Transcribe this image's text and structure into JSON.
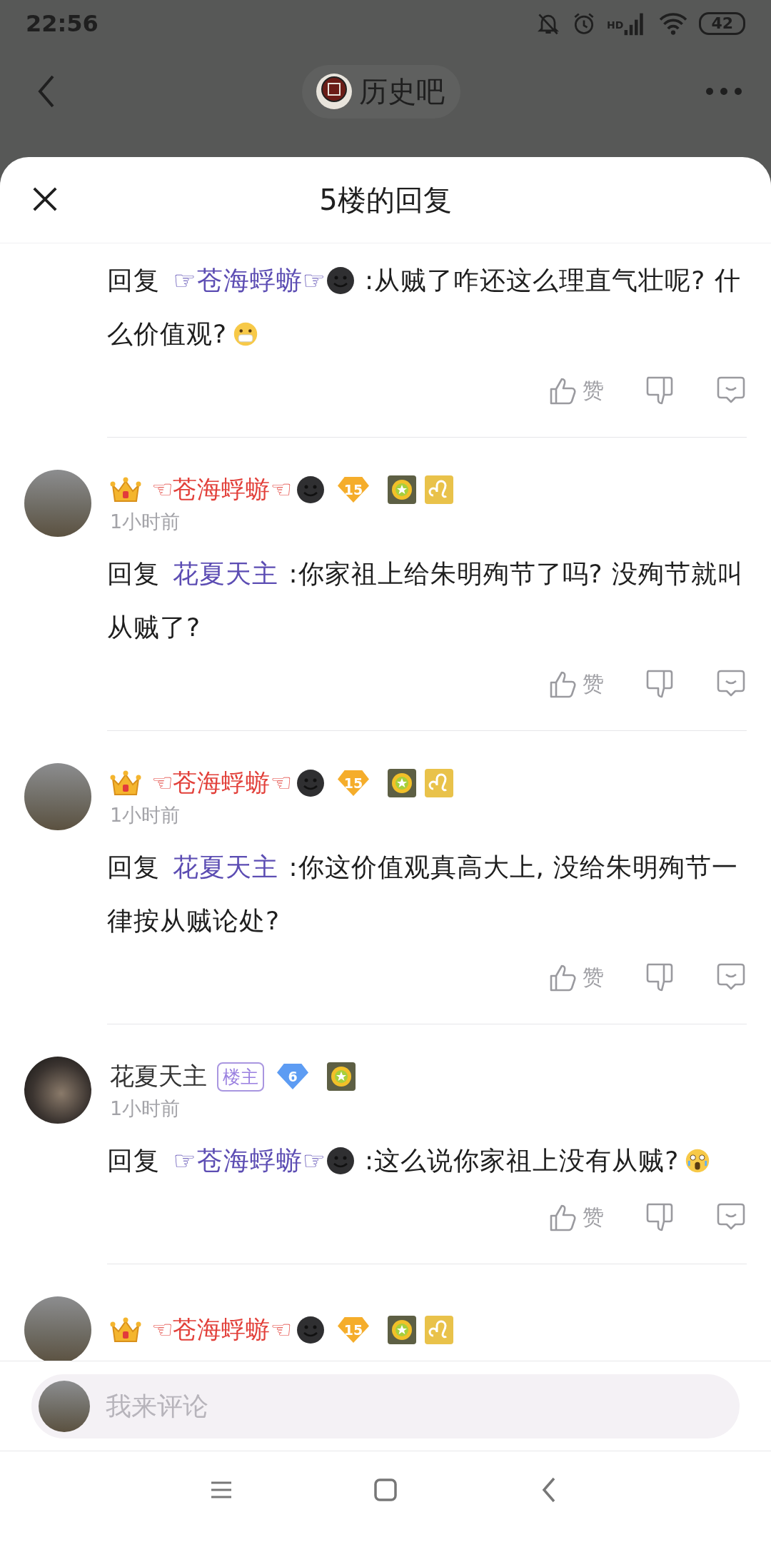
{
  "status_bar": {
    "time": "22:56",
    "network_label": "HD",
    "battery": "42"
  },
  "nav": {
    "forum": "历史吧"
  },
  "sheet": {
    "title": "5楼的回复"
  },
  "comments": [
    {
      "reply": {
        "prefix": "回复",
        "target": {
          "name": "☞苍海蜉蝣☞",
          "kind": "vip"
        },
        "text": ":从贼了咋还这么理直气壮呢? 什么价值观?",
        "emoji": {
          "kind": "mask"
        }
      },
      "like_label": "赞"
    },
    {
      "author": {
        "kind": "vip",
        "name": "☜苍海蜉蝣☜",
        "level": "15",
        "time": "1小时前"
      },
      "reply": {
        "prefix": "回复",
        "target": {
          "name": "花夏天主",
          "kind": "plain"
        },
        "text": ":你家祖上给朱明殉节了吗? 没殉节就叫从贼了?"
      },
      "like_label": "赞"
    },
    {
      "author": {
        "kind": "vip",
        "name": "☜苍海蜉蝣☜",
        "level": "15",
        "time": "1小时前"
      },
      "reply": {
        "prefix": "回复",
        "target": {
          "name": "花夏天主",
          "kind": "plain"
        },
        "text": ":你这价值观真高大上, 没给朱明殉节一律按从贼论处?"
      },
      "like_label": "赞"
    },
    {
      "author": {
        "kind": "plain",
        "name": "花夏天主",
        "tag": "楼主",
        "level": "6",
        "time": "1小时前"
      },
      "reply": {
        "prefix": "回复",
        "target": {
          "name": "☞苍海蜉蝣☞",
          "kind": "vip"
        },
        "text": ":这么说你家祖上没有从贼?",
        "emoji": {
          "kind": "scream"
        }
      },
      "like_label": "赞"
    },
    {
      "author": {
        "kind": "vip",
        "name": "☜苍海蜉蝣☜",
        "level": "15"
      }
    }
  ],
  "composer": {
    "placeholder": "我来评论"
  }
}
